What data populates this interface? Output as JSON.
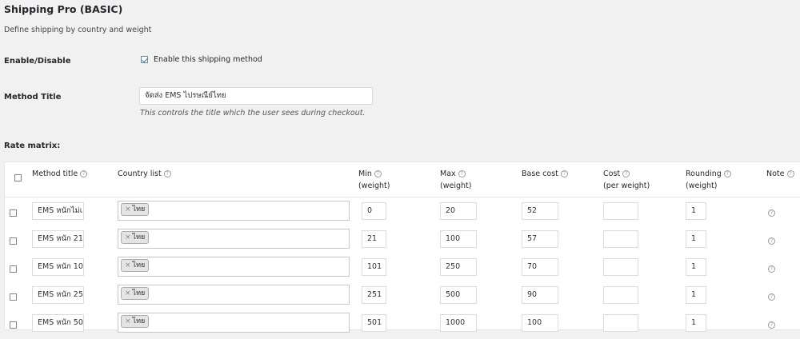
{
  "header": {
    "title": "Shipping Pro (BASIC)",
    "description": "Define shipping by country and weight"
  },
  "enable": {
    "label": "Enable/Disable",
    "checkbox_label": "Enable this shipping method",
    "checked": true
  },
  "method_title": {
    "label": "Method Title",
    "value": "จัดส่ง EMS ไปรษณีย์ไทย",
    "help": "This controls the title which the user sees during checkout."
  },
  "rate_matrix": {
    "label": "Rate matrix:",
    "columns": {
      "method_title": "Method title",
      "country_list": "Country list",
      "min_line1": "Min",
      "min_line2": "(weight)",
      "max_line1": "Max",
      "max_line2": "(weight)",
      "base_cost": "Base cost",
      "cost_line1": "Cost",
      "cost_line2": "(per weight)",
      "rounding_line1": "Rounding",
      "rounding_line2": "(weight)",
      "note": "Note"
    },
    "rows": [
      {
        "title": "EMS หนักไม่เ",
        "country": "ไทย",
        "min": "0",
        "max": "20",
        "base": "52",
        "cost": "",
        "rounding": "1"
      },
      {
        "title": "EMS หนัก 21",
        "country": "ไทย",
        "min": "21",
        "max": "100",
        "base": "57",
        "cost": "",
        "rounding": "1"
      },
      {
        "title": "EMS หนัก 10",
        "country": "ไทย",
        "min": "101",
        "max": "250",
        "base": "70",
        "cost": "",
        "rounding": "1"
      },
      {
        "title": "EMS หนัก 25",
        "country": "ไทย",
        "min": "251",
        "max": "500",
        "base": "90",
        "cost": "",
        "rounding": "1"
      },
      {
        "title": "EMS หนัก 50",
        "country": "ไทย",
        "min": "501",
        "max": "1000",
        "base": "100",
        "cost": "",
        "rounding": "1"
      }
    ]
  },
  "icons": {
    "help": "question-circle-icon",
    "remove_tag": "x-icon",
    "check": "checkmark-icon"
  },
  "colors": {
    "background": "#f1f1f1",
    "table_bg": "#ffffff",
    "text": "#23282d",
    "check": "#1e8cbe"
  }
}
